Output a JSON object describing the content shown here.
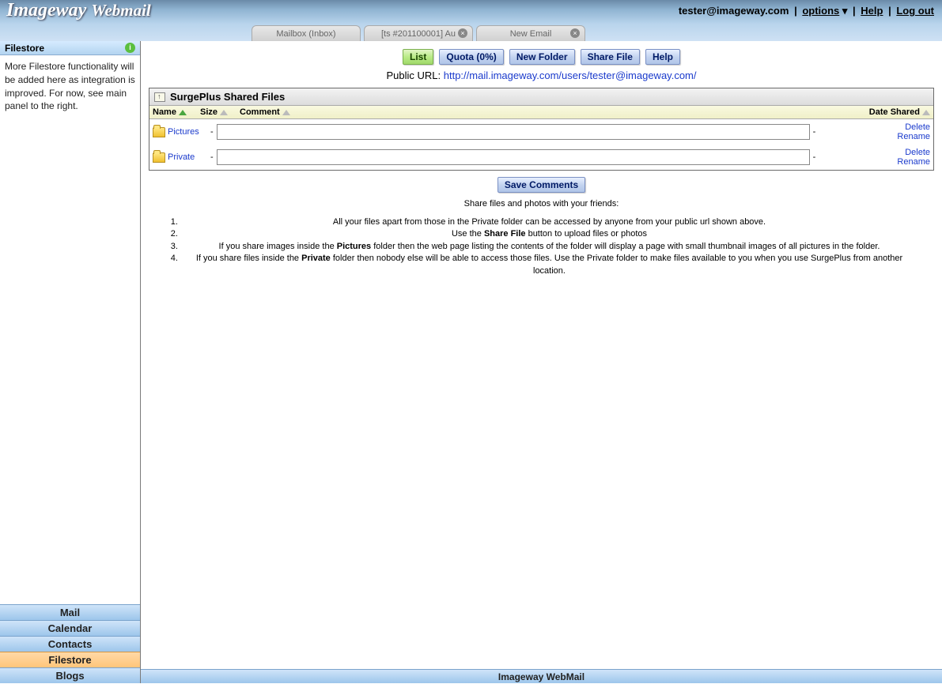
{
  "header": {
    "logo_main": "Imageway",
    "logo_sub": "Webmail",
    "user_email": "tester@imageway.com",
    "options": "options",
    "help": "Help",
    "logout": "Log out"
  },
  "tabs": [
    {
      "label": "Mailbox (Inbox)",
      "closable": false
    },
    {
      "label": "[ts #201100001] Au",
      "closable": true
    },
    {
      "label": "New Email",
      "closable": true
    }
  ],
  "sidebar": {
    "title": "Filestore",
    "text": "More Filestore functionality will be added here as integration is improved. For now, see main panel to the right.",
    "nav": [
      "Mail",
      "Calendar",
      "Contacts",
      "Filestore",
      "Blogs"
    ],
    "active_index": 3
  },
  "toolbar": {
    "list": "List",
    "quota": "Quota (0%)",
    "new_folder": "New Folder",
    "share_file": "Share File",
    "help": "Help"
  },
  "public_url": {
    "label": "Public URL: ",
    "link": "http://mail.imageway.com/users/tester@imageway.com/"
  },
  "panel": {
    "title": "SurgePlus Shared Files",
    "cols": {
      "name": "Name",
      "size": "Size",
      "comment": "Comment",
      "date": "Date Shared"
    },
    "rows": [
      {
        "name": "Pictures",
        "size": "-",
        "comment": "",
        "date": "-",
        "delete": "Delete",
        "rename": "Rename"
      },
      {
        "name": "Private",
        "size": "-",
        "comment": "",
        "date": "-",
        "delete": "Delete",
        "rename": "Rename"
      }
    ],
    "save": "Save Comments"
  },
  "info": {
    "heading": "Share files and photos with your friends:",
    "items": [
      "All your files apart from those in the Private folder can be accessed by anyone from your public url shown above.",
      "Use the <b>Share File</b> button to upload files or photos",
      "If you share images inside the <b>Pictures</b> folder then the web page listing the contents of the folder will display a page with small thumbnail images of all pictures in the folder.",
      "If you share files inside the <b>Private</b> folder then nobody else will be able to access those files. Use the Private folder to make files available to you when you use SurgePlus from another location."
    ]
  },
  "footer": "Imageway WebMail"
}
